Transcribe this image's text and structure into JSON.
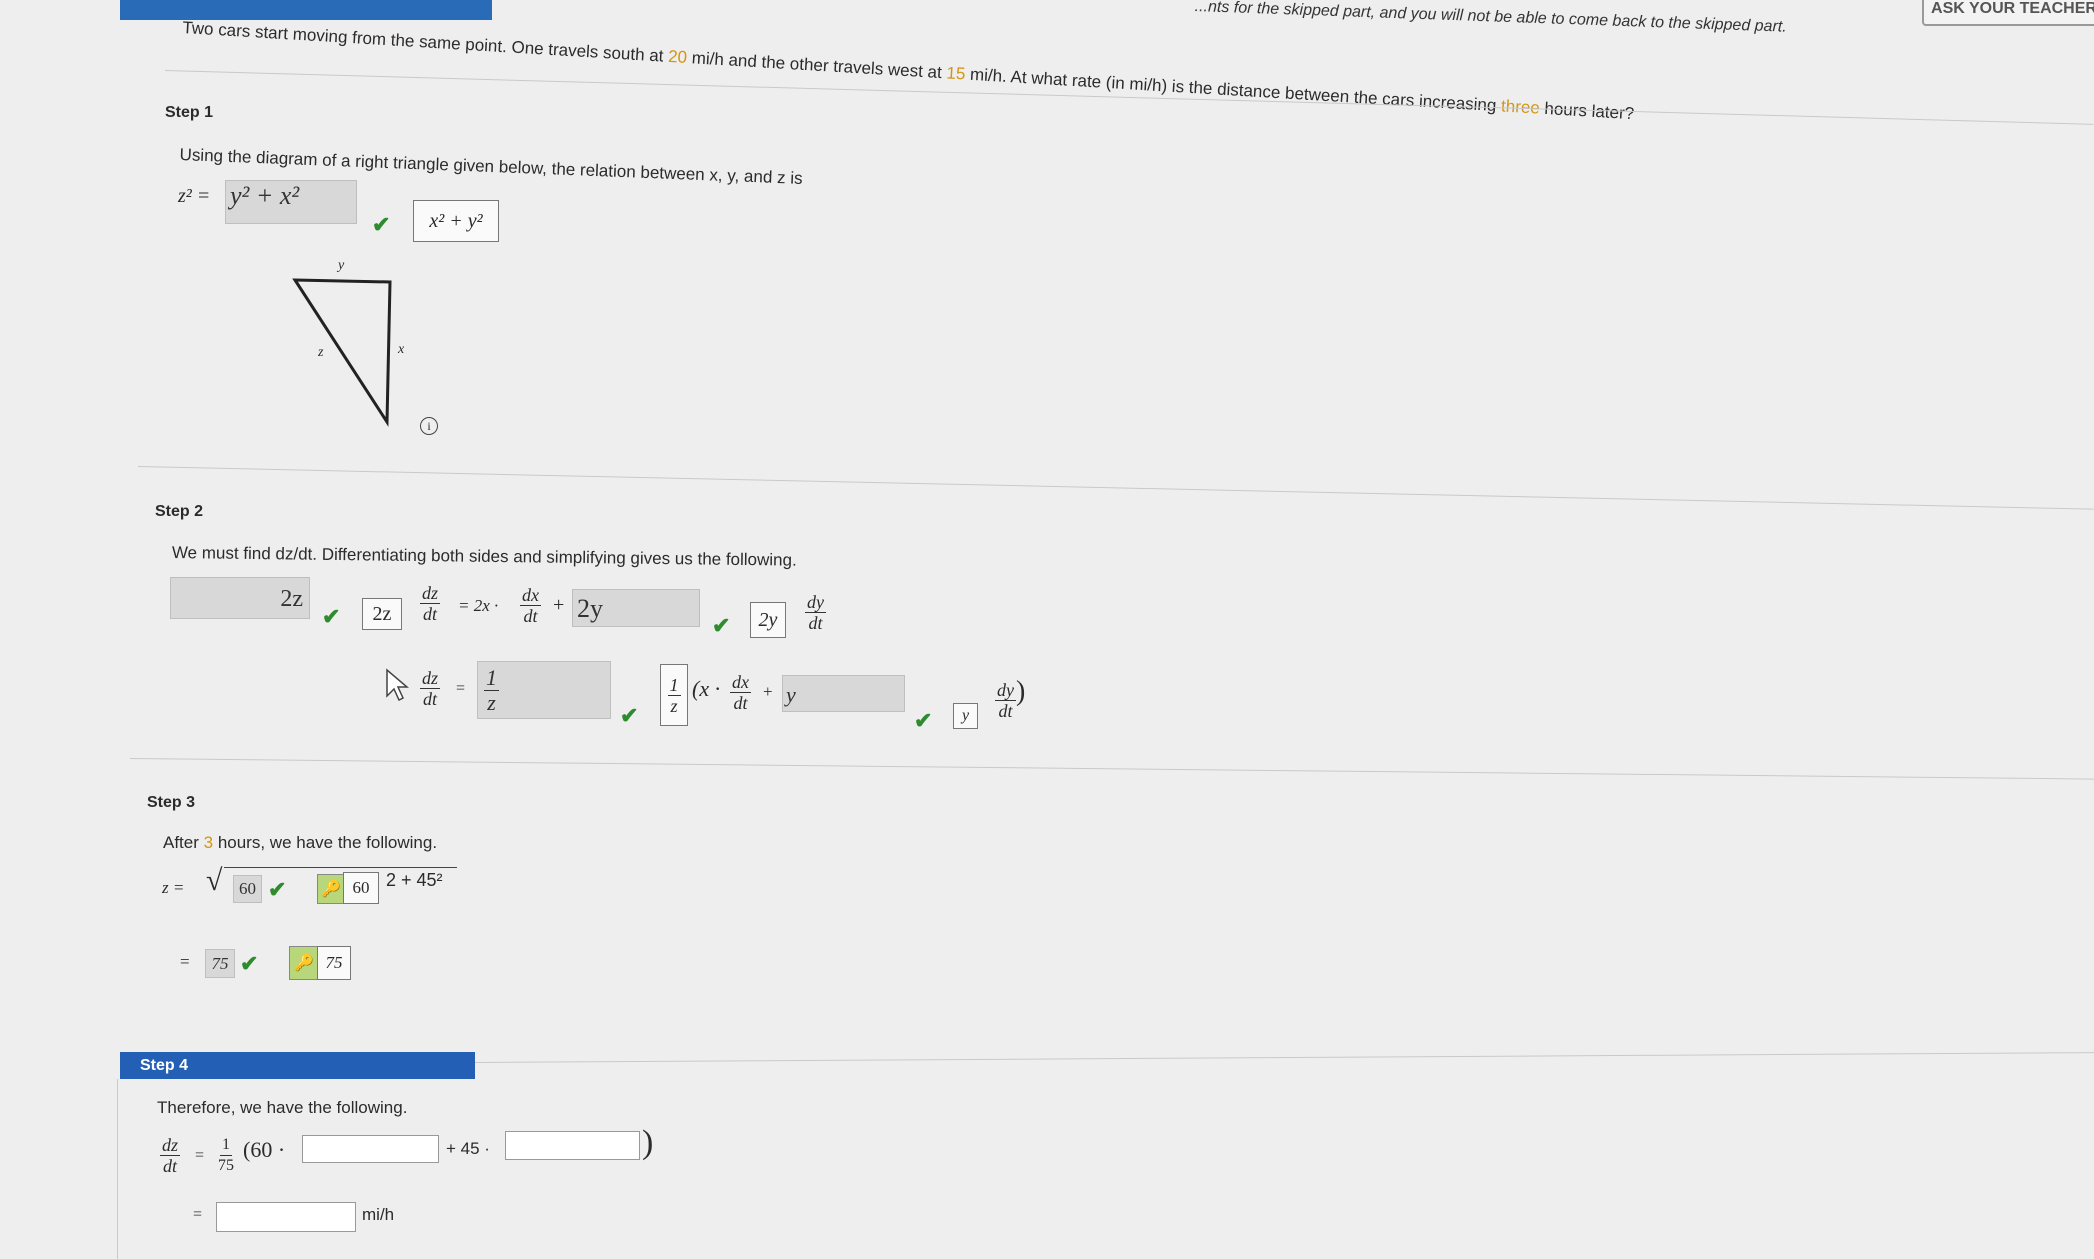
{
  "header": {
    "notice": "...nts for the skipped part, and you will not be able to come back to the skipped part.",
    "ask_teacher": "ASK YOUR TEACHER"
  },
  "problem": {
    "part1": "Two cars start moving from the same point. One travels south at ",
    "speed_south": "20",
    "part2": " mi/h and the other travels west at ",
    "speed_west": "15",
    "part3": " mi/h. At what rate (in mi/h) is the distance between the cars increasing ",
    "hours": "three",
    "part4": " hours later?"
  },
  "step1": {
    "label": "Step 1",
    "instruction": "Using the diagram of a right triangle given below, the relation between x, y, and z is",
    "lhs": "z² =",
    "answer": "y² + x²",
    "key": "x² + y²",
    "triangle": {
      "top_label": "y",
      "right_label": "x",
      "hyp_label": "z"
    },
    "info_icon": "i"
  },
  "step2": {
    "label": "Step 2",
    "instruction": "We must find dz/dt. Differentiating both sides and simplifying gives us the following.",
    "row1": {
      "answer1": "2z",
      "key1": "2z",
      "dz": "dz",
      "dt": "dt",
      "mid": "= 2x ·",
      "dx": "dx",
      "plus": "+",
      "answer2": "2y",
      "key2": "2y",
      "dy": "dy"
    },
    "row2": {
      "dz": "dz",
      "dt": "dt",
      "eq": "=",
      "answer_num": "1",
      "answer_den": "z",
      "key_num": "1",
      "key_den": "z",
      "open": "(x ·",
      "dx": "dx",
      "plus": "+",
      "answer_y": "y",
      "key_y": "y",
      "dy": "dy",
      "close": ")"
    }
  },
  "step3": {
    "label": "Step 3",
    "instruction_pre": "After ",
    "hours": "3",
    "instruction_post": " hours, we have the following.",
    "lhs": "z =",
    "answer1": "60",
    "key1": "60",
    "tail": "2 + 45²",
    "eq": "=",
    "answer2": "75",
    "key2": "75"
  },
  "step4": {
    "label": "Step 4",
    "instruction": "Therefore, we have the following.",
    "dz": "dz",
    "dt": "dt",
    "eq": "=",
    "coef_num": "1",
    "coef_den": "75",
    "open": "(60 ·",
    "mid": "+ 45 ·",
    "close": ")",
    "eq2": "=",
    "unit": "mi/h"
  },
  "colors": {
    "accent": "#2360b5",
    "check": "#2e8b2e",
    "highlight": "#d4960f"
  }
}
